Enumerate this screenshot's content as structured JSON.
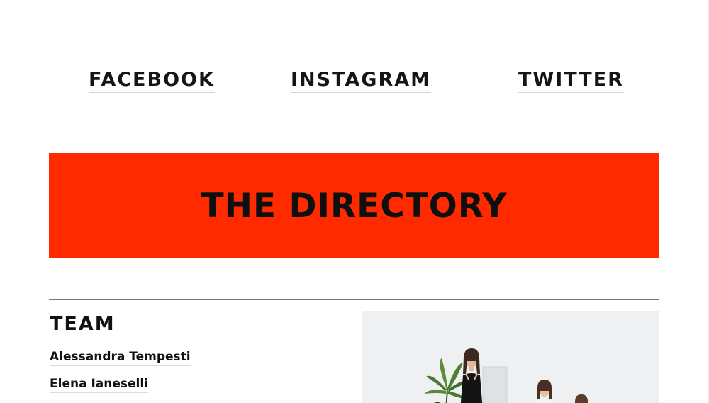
{
  "social": {
    "links": [
      {
        "label": "FACEBOOK"
      },
      {
        "label": "INSTAGRAM"
      },
      {
        "label": "TWITTER"
      }
    ]
  },
  "hero": {
    "title": "THE DIRECTORY"
  },
  "team": {
    "heading": "TEAM",
    "members": [
      {
        "name": "Alessandra Tempesti"
      },
      {
        "name": "Elena Ianeselli"
      }
    ],
    "photo": {
      "alt": "team-photo"
    }
  },
  "colors": {
    "accent": "#ff2a00",
    "text": "#111111",
    "rule": "#777777",
    "background": "#ffffff"
  }
}
